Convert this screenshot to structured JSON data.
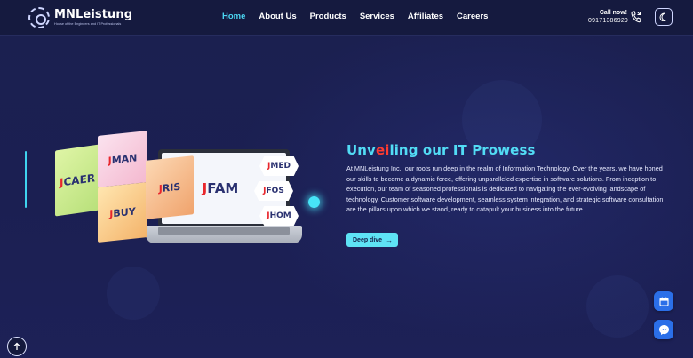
{
  "brand": {
    "name": "MNLeistung",
    "tagline": "House of the Engineers and IT Professionals"
  },
  "nav": {
    "items": [
      {
        "label": "Home",
        "active": true
      },
      {
        "label": "About Us",
        "active": false
      },
      {
        "label": "Products",
        "active": false
      },
      {
        "label": "Services",
        "active": false
      },
      {
        "label": "Affiliates",
        "active": false
      },
      {
        "label": "Careers",
        "active": false
      }
    ]
  },
  "contact": {
    "label": "Call now!",
    "number": "09171386929",
    "icon": "phone-icon"
  },
  "theme_toggle": {
    "icon": "moon-icon"
  },
  "hero": {
    "title_prefix": "Unv",
    "title_accent": "ei",
    "title_suffix": "ling our IT Prowess",
    "body": "At MNLeistung Inc., our roots run deep in the realm of Information Technology. Over the years, we have honed our skills to become a dynamic force, offering unparalleled expertise in software solutions. From inception to execution, our team of seasoned professionals is dedicated to navigating the ever-evolving landscape of technology. Customer software development, seamless system integration, and strategic software consultation are the pillars upon which we stand, ready to catapult your business into the future.",
    "cta_label": "Deep dive",
    "cta_icon": "arrow-right-icon"
  },
  "products": {
    "cards": [
      "CAER",
      "MAN",
      "BUY",
      "RIS",
      "FAM"
    ],
    "hexes": [
      "MED",
      "FOS",
      "HOM"
    ]
  },
  "colors": {
    "accent": "#4bd6f2",
    "background": "#1b2050",
    "navbar": "#151a3f",
    "cta": "#5ee3f5",
    "float_button": "#2b6fe8",
    "logo_mark_red": "#e8262c"
  },
  "floating": {
    "calendar_icon": "calendar-icon",
    "messenger_icon": "messenger-icon",
    "scroll_top_icon": "arrow-up-icon"
  }
}
